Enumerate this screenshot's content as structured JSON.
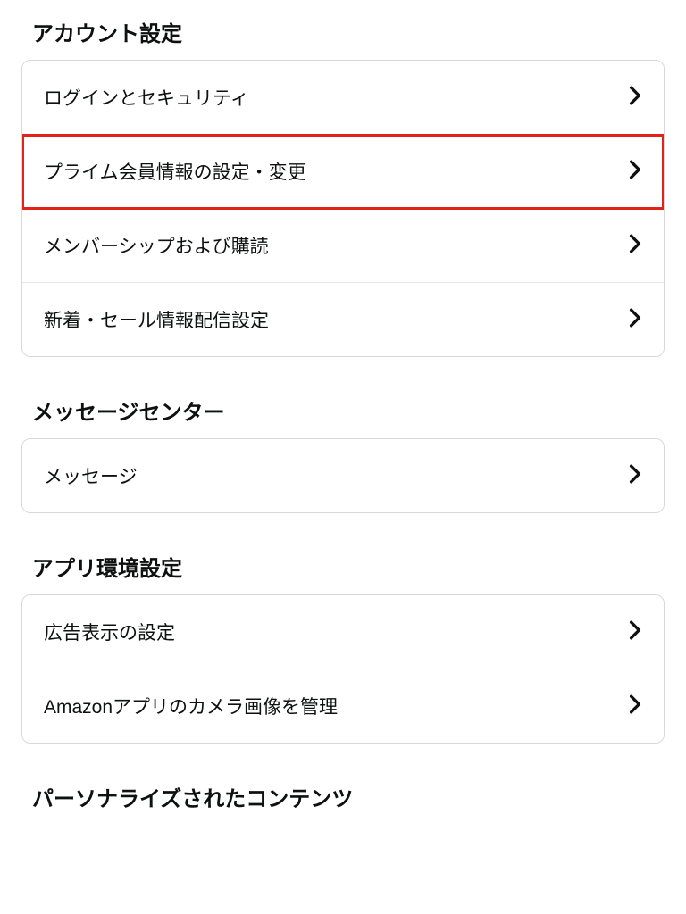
{
  "sections": [
    {
      "title": "アカウント設定",
      "items": [
        {
          "label": "ログインとセキュリティ",
          "highlighted": false
        },
        {
          "label": "プライム会員情報の設定・変更",
          "highlighted": true
        },
        {
          "label": "メンバーシップおよび購読",
          "highlighted": false
        },
        {
          "label": "新着・セール情報配信設定",
          "highlighted": false
        }
      ]
    },
    {
      "title": "メッセージセンター",
      "items": [
        {
          "label": "メッセージ",
          "highlighted": false
        }
      ]
    },
    {
      "title": "アプリ環境設定",
      "items": [
        {
          "label": "広告表示の設定",
          "highlighted": false
        },
        {
          "label": "Amazonアプリのカメラ画像を管理",
          "highlighted": false
        }
      ]
    },
    {
      "title": "パーソナライズされたコンテンツ",
      "items": []
    }
  ]
}
